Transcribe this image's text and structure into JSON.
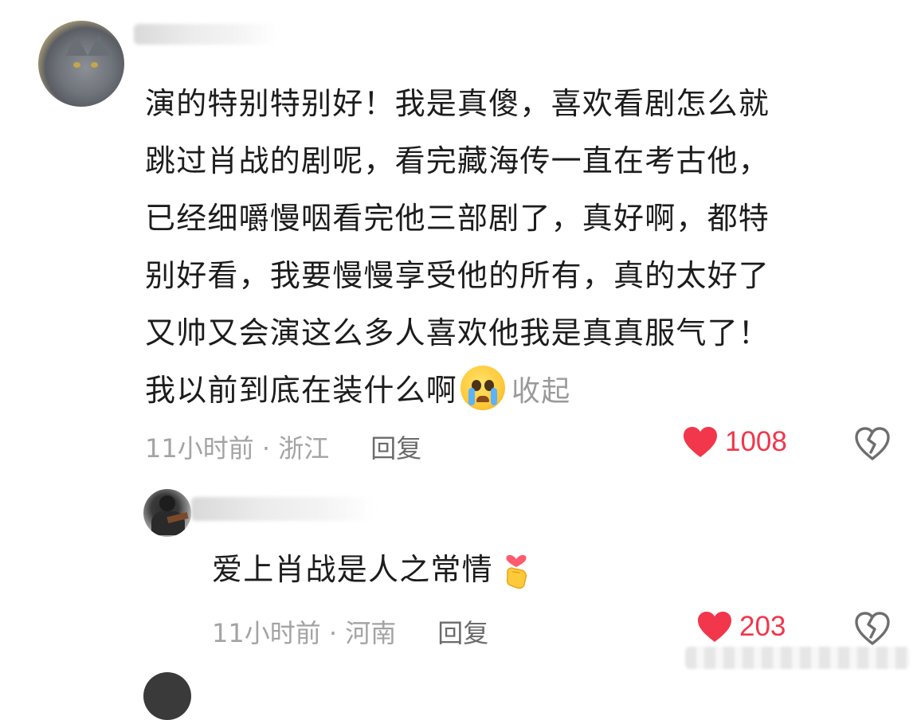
{
  "comments": [
    {
      "avatar_icon": "gray-cat-avatar",
      "text_lines": [
        "演的特别特别好！我是真傻，喜欢看剧怎么就",
        "跳过肖战的剧呢，看完藏海传一直在考古他，",
        "已经细嚼慢咽看完他三部剧了，真好啊，都特",
        "别好看，我要慢慢享受他的所有，真的太好了",
        "又帅又会演这么多人喜欢他我是真真服气了！",
        "我以前到底在装什么啊"
      ],
      "emoji_icon": "crying-face-emoji",
      "collapse_label": "收起",
      "time": "11小时前 · 浙江",
      "reply_label": "回复",
      "likes": "1008"
    },
    {
      "avatar_icon": "person-avatar",
      "text": "爱上肖战是人之常情",
      "emoji_icon": "finger-heart-emoji",
      "time": "11小时前 · 河南",
      "reply_label": "回复",
      "likes": "203"
    }
  ],
  "colors": {
    "like": "#f2364b",
    "meta": "#a3a3a3",
    "reply": "#6b6b6b",
    "text": "#1c1c1c"
  }
}
